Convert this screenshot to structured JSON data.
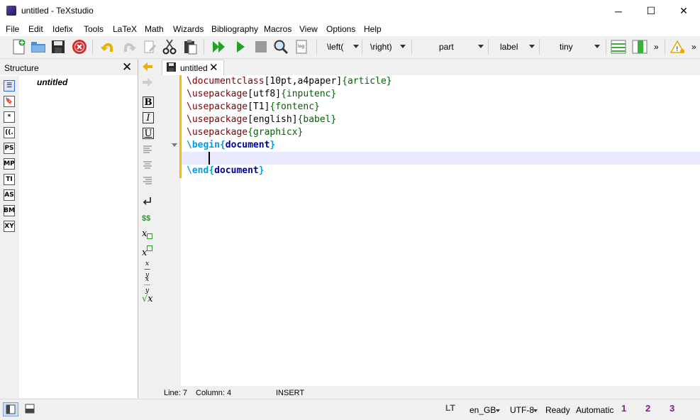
{
  "window": {
    "title": "untitled - TeXstudio",
    "controls": {
      "minimize": "─",
      "maximize": "☐",
      "close": "✕"
    }
  },
  "menu": [
    "File",
    "Edit",
    "Idefix",
    "Tools",
    "LaTeX",
    "Math",
    "Wizards",
    "Bibliography",
    "Macros",
    "View",
    "Options",
    "Help"
  ],
  "toolbar": {
    "left_delim": "\\left(",
    "right_delim": "\\right)",
    "sectioning": "part",
    "reference": "label",
    "size": "tiny",
    "more": "»"
  },
  "structure": {
    "title": "Structure",
    "close": "✕",
    "root_item": "untitled",
    "side_icons": [
      "☰",
      "🔖",
      "*",
      "((.",
      "PS",
      "MP",
      "TI",
      "AS",
      "BM",
      "XY"
    ]
  },
  "editor": {
    "tab_label": "untitled",
    "tab_close": "✕",
    "lines": [
      {
        "cmd": "\\documentclass",
        "opt": "[10pt,a4paper]",
        "arg": "{article}"
      },
      {
        "cmd": "\\usepackage",
        "opt": "[utf8]",
        "arg": "{inputenc}"
      },
      {
        "cmd": "\\usepackage",
        "opt": "[T1]",
        "arg": "{fontenc}"
      },
      {
        "cmd": "\\usepackage",
        "opt": "[english]",
        "arg": "{babel}"
      },
      {
        "cmd": "\\usepackage",
        "opt": "",
        "arg": "{graphicx}"
      },
      {
        "cmd": "\\begin",
        "env": "document"
      },
      {
        "cmd": "",
        "opt": "",
        "arg": ""
      },
      {
        "cmd": "\\end",
        "env": "document"
      }
    ]
  },
  "format_icons": {
    "bold": "B",
    "italic": "I",
    "underline": "U",
    "math": "$$"
  },
  "status_inner": {
    "line": "Line: 7",
    "column": "Column: 4",
    "mode": "INSERT"
  },
  "statusbar": {
    "lt": "LT",
    "language": "en_GB",
    "encoding": "UTF-8",
    "ready": "Ready",
    "automatic": "Automatic",
    "bookmarks": [
      "1",
      "2",
      "3"
    ]
  },
  "colors": {
    "command": "#800000",
    "argument": "#006400",
    "environment": "#00a0e0",
    "marker": "#f0c000"
  }
}
